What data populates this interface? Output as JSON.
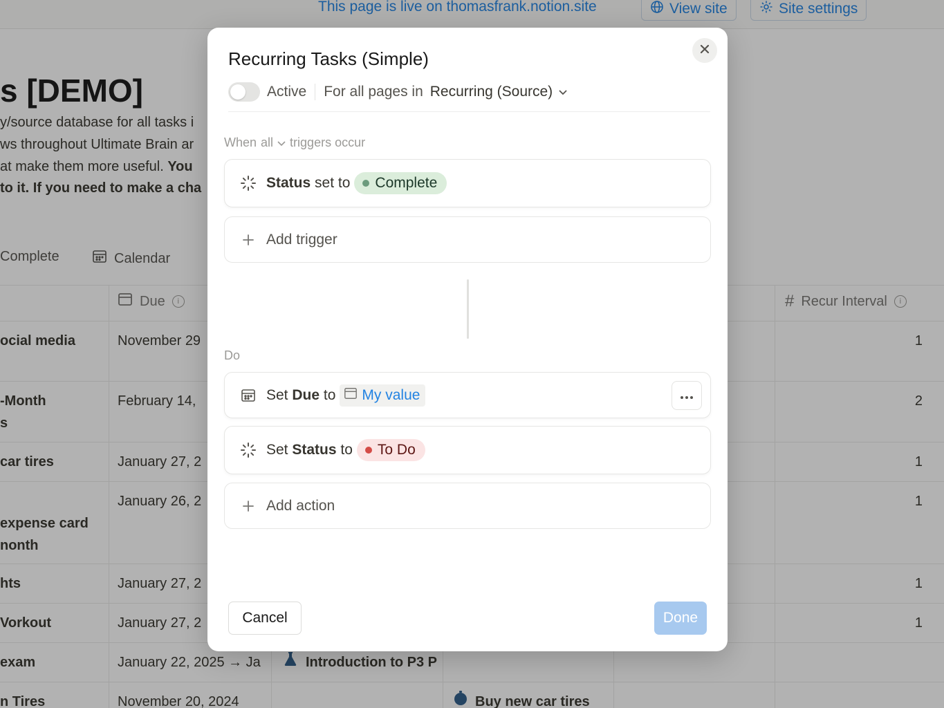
{
  "background": {
    "topbar": {
      "live_text": "This page is live on thomasfrank.notion.site",
      "view_site": "View site",
      "site_settings": "Site settings"
    },
    "page_title": "s [DEMO]",
    "description": [
      {
        "text": "y/source database for all tasks i",
        "bold": ""
      },
      {
        "text": "ws throughout Ultimate Brain ar",
        "bold": ""
      },
      {
        "text": "at make them more useful. ",
        "bold": "You"
      },
      {
        "text": "",
        "bold": "to it. If you need to make a cha"
      }
    ],
    "view_tabs": [
      "Complete",
      "Calendar"
    ],
    "headers": {
      "due": "Due",
      "recur_interval": "Recur Interval"
    },
    "rows": [
      {
        "name": "ocial media",
        "due": "November 29",
        "interval": "1"
      },
      {
        "name": "-Month",
        "name2": "s",
        "due": "February 14,",
        "interval": "2"
      },
      {
        "name": " car tires",
        "due": "January 27, 2",
        "interval": "1"
      },
      {
        "name": "expense card",
        "name2": "nonth",
        "due": "January 26, 2",
        "interval": "1"
      },
      {
        "name": "hts",
        "due": "January 27, 2",
        "interval": "1"
      },
      {
        "name": "Vorkout",
        "due": "January 27, 2",
        "interval": "1"
      },
      {
        "name": " exam",
        "due": "January 22, 2025 → Ja",
        "project": "Introduction to P3 P",
        "interval": ""
      },
      {
        "name": "n Tires",
        "due": "November 20, 2024",
        "project": "Buy new car tires",
        "interval": ""
      }
    ]
  },
  "modal": {
    "title": "Recurring Tasks (Simple)",
    "active_label": "Active",
    "scope_prefix": "For all pages in",
    "scope_target": "Recurring (Source)",
    "when_prefix": "When",
    "when_mode": "all",
    "when_suffix": "triggers occur",
    "trigger": {
      "property": "Status",
      "verb": "set to",
      "value": "Complete",
      "value_color": "#dbeddb"
    },
    "add_trigger": "Add trigger",
    "do_label": "Do",
    "actions": [
      {
        "prefix": "Set",
        "property": "Due",
        "verb": "to",
        "value": "My value"
      },
      {
        "prefix": "Set",
        "property": "Status",
        "verb": "to",
        "value": "To Do",
        "value_color": "#fbe4e4"
      }
    ],
    "add_action": "Add action",
    "cancel": "Cancel",
    "done": "Done"
  }
}
